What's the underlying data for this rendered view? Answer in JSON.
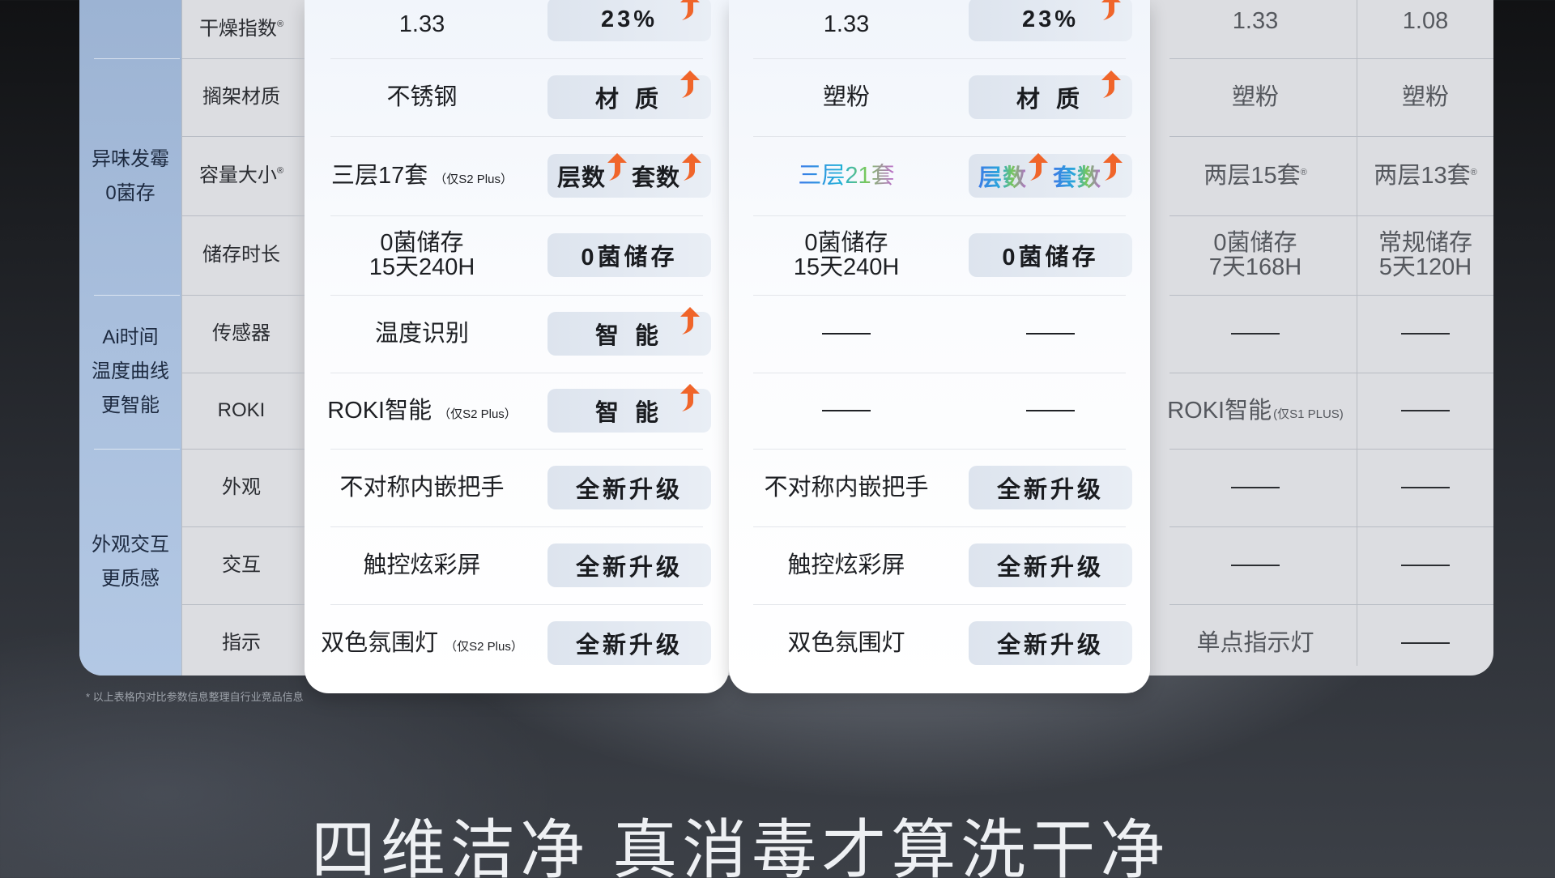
{
  "categories": [
    {
      "lines": [
        "异味发霉",
        "0菌存"
      ]
    },
    {
      "lines": [
        "Ai时间",
        "温度曲线",
        "更智能"
      ]
    },
    {
      "lines": [
        "外观交互",
        "更质感"
      ]
    }
  ],
  "rows": {
    "dry": {
      "label": "干燥指数",
      "mark": "®",
      "c1": "1.33",
      "p1": "23%",
      "c2": "1.33",
      "p2": "23%",
      "c3": "1.33",
      "c4": "1.08"
    },
    "rack": {
      "label": "搁架材质",
      "c1": "不锈钢",
      "p1": "材 质",
      "c2": "塑粉",
      "p2": "材 质",
      "c3": "塑粉",
      "c4": "塑粉"
    },
    "capacity": {
      "label": "容量大小",
      "mark": "®",
      "c1": "三层17套",
      "c1_note": "（仅S2 Plus）",
      "p1a": "层数",
      "p1b": "套数",
      "c2": "三层21套",
      "p2a": "层数",
      "p2b": "套数",
      "c3": "两层15套",
      "c3_mark": "®",
      "c4": "两层13套",
      "c4_mark": "®"
    },
    "storage": {
      "label": "储存时长",
      "c1_l1": "0菌储存",
      "c1_l2": "15天240H",
      "p1": "0菌储存",
      "c2_l1": "0菌储存",
      "c2_l2": "15天240H",
      "p2": "0菌储存",
      "c3_l1": "0菌储存",
      "c3_l2": "7天168H",
      "c4_l1": "常规储存",
      "c4_l2": "5天120H"
    },
    "sensor": {
      "label": "传感器",
      "c1": "温度识别",
      "p1": "智 能"
    },
    "roki": {
      "label": "ROKI",
      "c1": "ROKI智能",
      "c1_note": "（仅S2 Plus）",
      "p1": "智 能",
      "c3": "ROKI智能",
      "c3_note": "(仅S1 PLUS)"
    },
    "look": {
      "label": "外观",
      "c1": "不对称内嵌把手",
      "p1": "全新升级",
      "c2": "不对称内嵌把手",
      "p2": "全新升级"
    },
    "interact": {
      "label": "交互",
      "c1": "触控炫彩屏",
      "p1": "全新升级",
      "c2": "触控炫彩屏",
      "p2": "全新升级"
    },
    "indicator": {
      "label": "指示",
      "c1": "双色氛围灯",
      "c1_note": "（仅S2 Plus）",
      "p1": "全新升级",
      "c2": "双色氛围灯",
      "p2": "全新升级",
      "c3": "单点指示灯"
    }
  },
  "footnote": "* 以上表格内对比参数信息整理自行业竞品信息",
  "headline": "四维洁净 真消毒才算洗干净",
  "colors": {
    "arrow": "#f0652a",
    "category_bg": "#a9bfdd"
  }
}
